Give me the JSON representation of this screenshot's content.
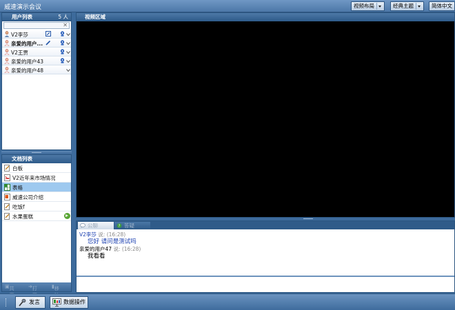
{
  "window": {
    "title": "威速演示会议"
  },
  "toolbar": {
    "video_layout_label": "视频布局",
    "theme_label": "经典主题",
    "language_label": "简体中文"
  },
  "user_panel": {
    "title": "用户列表",
    "count": "5 人",
    "search_placeholder": "",
    "users": [
      {
        "name": "V2李莎"
      },
      {
        "name": "亲爱的用户..."
      },
      {
        "name": "V2王贾"
      },
      {
        "name": "亲爱的用户43"
      },
      {
        "name": "亲爱的用户48"
      }
    ]
  },
  "doc_panel": {
    "title": "文档列表",
    "docs": [
      {
        "name": "白板",
        "icon": "whiteboard-icon"
      },
      {
        "name": "V2近年来市场情况",
        "icon": "pdf-icon"
      },
      {
        "name": "表格",
        "icon": "spreadsheet-icon"
      },
      {
        "name": "威速公司介绍",
        "icon": "presentation-icon"
      },
      {
        "name": "吃饭f",
        "icon": "whiteboard-icon"
      },
      {
        "name": "水果蛋糕",
        "icon": "whiteboard-icon"
      }
    ],
    "footer": {
      "share": "共享",
      "open": "打开",
      "delete": "移除"
    }
  },
  "video_panel": {
    "title": "视频区域"
  },
  "chat_panel": {
    "tabs": [
      {
        "label": "公聊"
      },
      {
        "label": "答疑"
      }
    ],
    "messages": [
      {
        "sender": "V2李莎",
        "says": "说:",
        "time": "(16:28)",
        "text": "您好 请问是测试吗"
      },
      {
        "sender": "亲爱的用户47",
        "says": "说:",
        "time": "(16:28)",
        "text": "我看看"
      }
    ]
  },
  "bottom_bar": {
    "speak_label": "发言",
    "data_ops_label": "数据操作"
  },
  "colors": {
    "frame_blue": "#3d6b9c",
    "header_blue": "#2e5b8a",
    "selected_row": "#9ec9ef",
    "sender_blue": "#1a3fb0"
  }
}
